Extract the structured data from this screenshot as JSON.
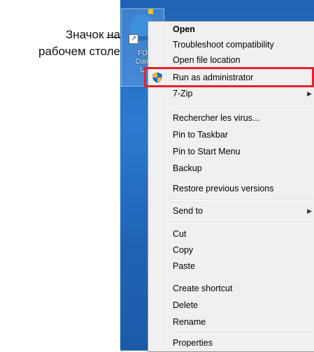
{
  "callout": {
    "line1": "Значок на",
    "line2": "рабочем столе"
  },
  "desktop_icon": {
    "label_lines": [
      "FO",
      "Cont",
      "U"
    ]
  },
  "context_menu": {
    "items": [
      {
        "label": "Open",
        "bold": true
      },
      {
        "label": "Troubleshoot compatibility"
      },
      {
        "label": "Open file location"
      },
      {
        "label": "Run as administrator",
        "icon": "uac-shield-icon",
        "highlighted": true
      },
      {
        "label": "7-Zip",
        "submenu": true
      },
      {
        "label": "Rechercher les virus..."
      },
      {
        "label": "Pin to Taskbar"
      },
      {
        "label": "Pin to Start Menu"
      },
      {
        "label": "Backup"
      },
      {
        "label": "Restore previous versions"
      },
      {
        "label": "Send to",
        "submenu": true
      },
      {
        "label": "Cut"
      },
      {
        "label": "Copy"
      },
      {
        "label": "Paste"
      },
      {
        "label": "Create shortcut"
      },
      {
        "label": "Delete"
      },
      {
        "label": "Rename"
      },
      {
        "label": "Properties"
      }
    ],
    "submenu_glyph": "▶"
  },
  "colors": {
    "highlight_border": "#e8202a",
    "desktop_blue": "#1f63b6",
    "menu_background": "#f0f0f0"
  }
}
